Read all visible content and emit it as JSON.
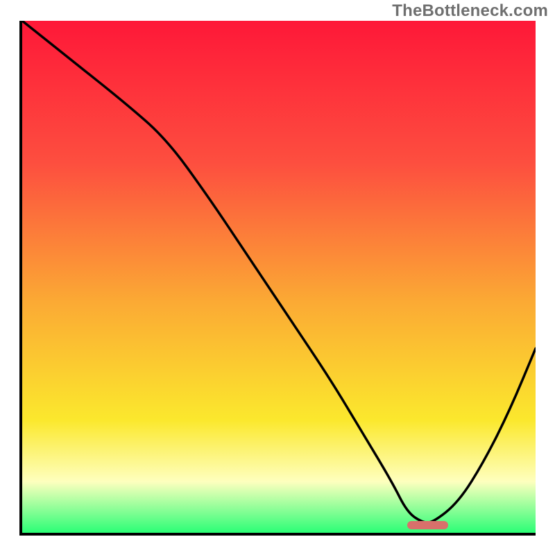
{
  "watermark": "TheBottleneck.com",
  "colors": {
    "gradient_top": "#fe1838",
    "gradient_upper_mid": "#fd4f3f",
    "gradient_mid": "#fbaa34",
    "gradient_lower_mid": "#fbe82d",
    "gradient_lower": "#feffbe",
    "gradient_bottom": "#2bfe76",
    "curve": "#000000",
    "marker": "#d9706b",
    "axis": "#000000"
  },
  "chart_data": {
    "type": "line",
    "title": "",
    "xlabel": "",
    "ylabel": "",
    "xlim": [
      0,
      100
    ],
    "ylim": [
      0,
      100
    ],
    "series": [
      {
        "name": "bottleneck-curve",
        "x": [
          0,
          10,
          20,
          28,
          36,
          44,
          52,
          60,
          66,
          72,
          75,
          78,
          80,
          85,
          90,
          95,
          100
        ],
        "values": [
          100,
          92,
          84,
          77,
          66,
          54,
          42,
          30,
          20,
          10,
          4,
          2,
          2,
          6,
          14,
          24,
          36
        ]
      }
    ],
    "annotations": [
      {
        "name": "optimal-marker",
        "x_start": 75,
        "x_end": 83,
        "y": 1.5
      }
    ],
    "background_gradient_stops": [
      {
        "offset": 0.0,
        "color": "#fe1838"
      },
      {
        "offset": 0.28,
        "color": "#fd4f3f"
      },
      {
        "offset": 0.55,
        "color": "#fbaa34"
      },
      {
        "offset": 0.78,
        "color": "#fbe82d"
      },
      {
        "offset": 0.9,
        "color": "#feffbe"
      },
      {
        "offset": 1.0,
        "color": "#2bfe76"
      }
    ]
  }
}
